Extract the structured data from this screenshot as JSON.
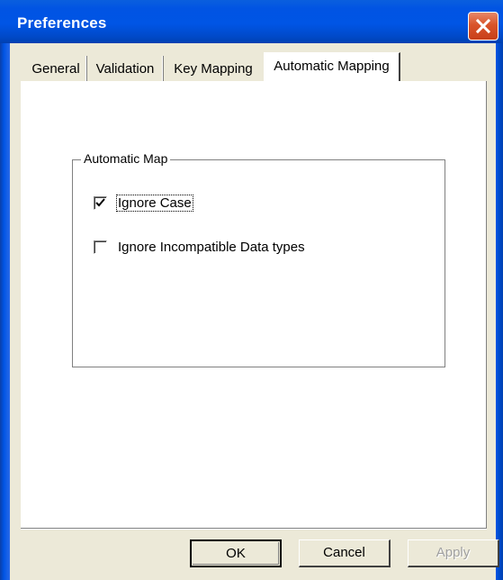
{
  "window": {
    "title": "Preferences",
    "colors": {
      "titlebar": "#0055e5",
      "close_button": "#d9542a",
      "face": "#ece9d8",
      "panel": "#ffffff"
    }
  },
  "tabs": [
    {
      "label": "General",
      "selected": false
    },
    {
      "label": "Validation",
      "selected": false
    },
    {
      "label": "Key Mapping",
      "selected": false
    },
    {
      "label": "Automatic Mapping",
      "selected": true
    }
  ],
  "group": {
    "legend": "Automatic Map",
    "options": [
      {
        "label": "Ignore Case",
        "checked": true,
        "focused": true
      },
      {
        "label": "Ignore Incompatible Data types",
        "checked": false,
        "focused": false
      }
    ]
  },
  "buttons": {
    "ok": {
      "label": "OK",
      "default": true
    },
    "cancel": {
      "label": "Cancel"
    },
    "apply": {
      "label": "Apply",
      "disabled": true
    }
  },
  "icons": {
    "close": "close-icon",
    "check": "checkmark-icon"
  }
}
